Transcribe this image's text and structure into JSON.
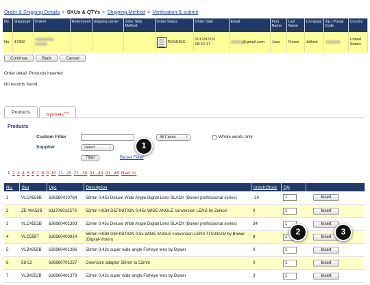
{
  "breadcrumb": {
    "step1": "Order & Shipping Details",
    "sep": ">",
    "step2": "SKUs & QTYs",
    "step3": "Shipping Method",
    "step4": "Verification & submit"
  },
  "order_table": {
    "headers": [
      "No",
      "Shipping#",
      "Order#",
      "Reference#",
      "shipping carrier",
      "order Ship Method",
      "Order Status",
      "Order Date",
      "Email",
      "First Name",
      "Last Name",
      "Company",
      "Zip / Postal Code",
      "Country"
    ],
    "row": {
      "no": "No",
      "shipping": "47800",
      "status": "PENDING",
      "date": "2012/02/09 08:32:17",
      "email": "j@gmail.com",
      "first": "Jose",
      "last": "Flores",
      "company": "Jsflorb",
      "country": "United States"
    }
  },
  "buttons": {
    "continue": "Continue",
    "back": "Back",
    "cancel": "Cancel"
  },
  "messages": {
    "detail": "Order detail: Products Inserted",
    "none": "No records found"
  },
  "tabs": {
    "products": "Products",
    "synsets": "SynSets",
    "synsets_sup": "new"
  },
  "filter": {
    "section": "Products",
    "custom_label": "Custom Filter",
    "supplier_label": "Supplier",
    "all_fields": "All Fields",
    "select": "Select",
    "whole_words": "Whole words only",
    "filter_btn": "Filter",
    "reset": "Reset Filter"
  },
  "pager": {
    "current": "1",
    "pages": [
      "2",
      "3",
      "4",
      "5",
      "6",
      "7",
      "8",
      "9",
      "10",
      "11...20",
      "21...30",
      "31...40",
      "41...48",
      "Next >>"
    ]
  },
  "products_table": {
    "headers": [
      "No.",
      "Sku",
      "Upc",
      "Description",
      "UnitsInStock",
      "Qty",
      ""
    ],
    "insert_label": "Insert",
    "rows": [
      {
        "no": "1",
        "sku": "VLC4558B",
        "upc": "636980410784",
        "desc": "58mm 0.45x Deluxe Wide Angle Digital Lens BLACK (Bower professional series)",
        "stock": "-10",
        "qty": "1"
      },
      {
        "no": "2",
        "sku": "ZE-WA52B",
        "upc": "811709012573",
        "desc": "52mm HIGH DEFINITION 0.45x WIDE ANGLE conversion LENS by Zeikos",
        "stock": "0",
        "qty": "1"
      },
      {
        "no": "3",
        "sku": "VLC4552B",
        "upc": "636980401393",
        "desc": "52mm 0.45x Deluxe Wide Angle Digital Lens BLACK (Bower professional series)",
        "stock": "34",
        "qty": "1"
      },
      {
        "no": "4",
        "sku": "VLC558T",
        "upc": "636980400914",
        "desc": "58mm HIGH DEFINITION 0.5x WIDE ANGLE conversion LENS TITANIUM by Bower (Digital-Vision)",
        "stock": "8",
        "qty": "1"
      },
      {
        "no": "5",
        "sku": "VLB4258B",
        "upc": "636980401386",
        "desc": "58mm 0.42x super wide angle Fisheye lens by Bower",
        "stock": "0",
        "qty": "1"
      },
      {
        "no": "6",
        "sku": "58-52",
        "upc": "636980701257",
        "desc": "Downsize adapter 58mm to 52mm",
        "stock": "0",
        "qty": "1"
      },
      {
        "no": "7",
        "sku": "VLB4252B",
        "upc": "636980401379",
        "desc": "52mm 0.42x super wide angle Fisheye lens by Bower",
        "stock": "3",
        "qty": "1"
      }
    ]
  },
  "markers": [
    "1",
    "2",
    "3"
  ]
}
